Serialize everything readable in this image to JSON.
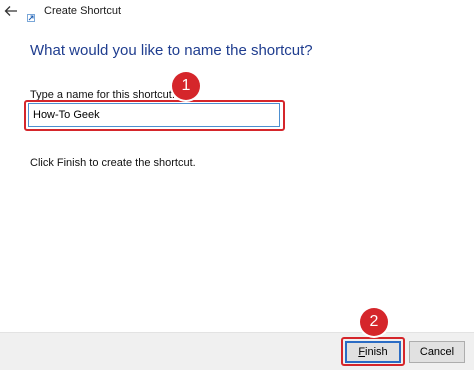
{
  "window": {
    "title": "Create Shortcut",
    "back_icon": "back-arrow-icon",
    "app_icon": "shortcut-icon"
  },
  "main": {
    "heading": "What would you like to name the shortcut?",
    "field_label": "Type a name for this shortcut:",
    "field_value": "How-To Geek",
    "instruction": "Click Finish to create the shortcut."
  },
  "footer": {
    "finish_prefix": "F",
    "finish_rest": "inish",
    "cancel_label": "Cancel"
  },
  "annotations": {
    "badge_1": "1",
    "badge_2": "2",
    "color": "#d5262b"
  }
}
